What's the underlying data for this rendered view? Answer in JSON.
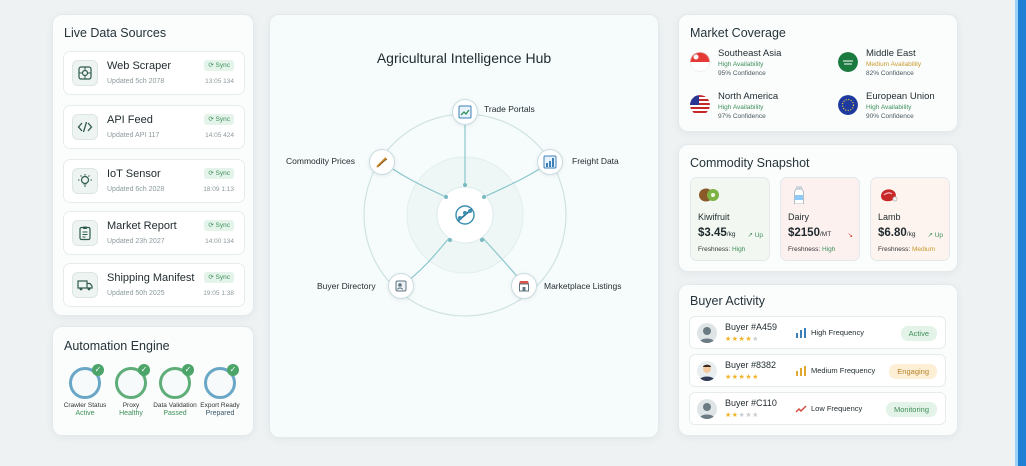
{
  "live_sources": {
    "title": "Live Data Sources",
    "items": [
      {
        "name": "Web Scraper",
        "updated": "Updated 5ch 2078",
        "sync": "Sync",
        "time": "13:05 134"
      },
      {
        "name": "API Feed",
        "updated": "Updated API 117",
        "sync": "Sync",
        "time": "14:05 424"
      },
      {
        "name": "IoT Sensor",
        "updated": "Updated 6ch 2028",
        "sync": "Sync",
        "time": "18:09 1:13"
      },
      {
        "name": "Market Report",
        "updated": "Updated 23h 2027",
        "sync": "Sync",
        "time": "14:00 134"
      },
      {
        "name": "Shipping Manifest",
        "updated": "Updated 50h 2025",
        "sync": "Sync",
        "time": "19:05 1:38"
      }
    ]
  },
  "automation": {
    "title": "Automation Engine",
    "items": [
      {
        "label": "Crawler Status",
        "status": "Active"
      },
      {
        "label": "Proxy",
        "status": "Healthy"
      },
      {
        "label": "Data Validation",
        "status": "Passed"
      },
      {
        "label": "Export Ready",
        "status": "Prepared"
      }
    ]
  },
  "hub": {
    "title": "Agricultural Intelligence Hub",
    "nodes": {
      "trade": "Trade Portals",
      "commodity": "Commodity Prices",
      "freight": "Freight Data",
      "buyer": "Buyer Directory",
      "marketplace": "Marketplace Listings"
    }
  },
  "coverage": {
    "title": "Market Coverage",
    "regions": [
      {
        "name": "Southeast Asia",
        "availability": "High Availability",
        "confidence": "95% Confidence",
        "level": "high"
      },
      {
        "name": "Middle East",
        "availability": "Medium Availability",
        "confidence": "82% Confidence",
        "level": "medium"
      },
      {
        "name": "North America",
        "availability": "High Availability",
        "confidence": "97% Confidence",
        "level": "high"
      },
      {
        "name": "European Union",
        "availability": "High Availability",
        "confidence": "90% Confidence",
        "level": "high"
      }
    ]
  },
  "snapshot": {
    "title": "Commodity Snapshot",
    "items": [
      {
        "name": "Kiwifruit",
        "price": "$3.45",
        "unit": "/kg",
        "trend": "↗ Up",
        "freshness_label": "Freshness:",
        "freshness": "High"
      },
      {
        "name": "Dairy",
        "price": "$2150",
        "unit": "/MT",
        "trend": "↘",
        "freshness_label": "Freshness:",
        "freshness": "High"
      },
      {
        "name": "Lamb",
        "price": "$6.80",
        "unit": "/kg",
        "trend": "↗ Up",
        "freshness_label": "Freshness:",
        "freshness": "Medium"
      }
    ],
    "colors": {
      "up": "#3f8f5b",
      "down": "#d0473a",
      "medium": "#c99a2e"
    }
  },
  "buyers": {
    "title": "Buyer Activity",
    "items": [
      {
        "name": "Buyer #A459",
        "rating": 4,
        "frequency": "High Frequency",
        "status": "Active"
      },
      {
        "name": "Buyer #8382",
        "rating": 5,
        "frequency": "Medium Frequency",
        "status": "Engaging"
      },
      {
        "name": "Buyer #C110",
        "rating": 2,
        "frequency": "Low Frequency",
        "status": "Monitoring"
      }
    ]
  }
}
